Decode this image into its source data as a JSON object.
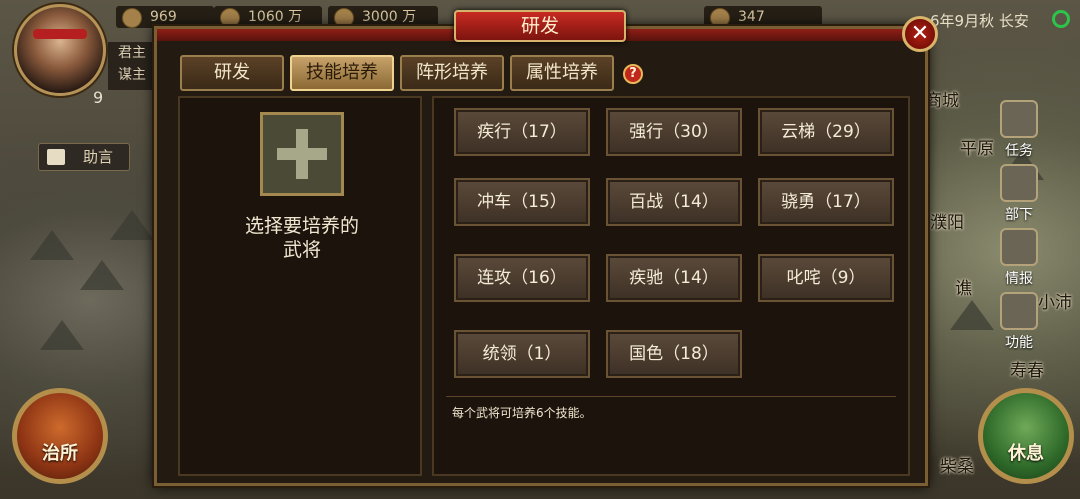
{
  "topbar": {
    "resources": [
      {
        "icon": "coin-icon",
        "value": "969"
      },
      {
        "icon": "grain-icon",
        "value": "1060 万"
      },
      {
        "icon": "troops-icon",
        "value": "3000 万"
      },
      {
        "icon": "scroll-icon",
        "value": "347"
      }
    ],
    "date": "6年9月秋 长安"
  },
  "player": {
    "level": "9",
    "lord_label": "君主",
    "strategist_label": "谋主",
    "help_button": "助言"
  },
  "map": {
    "cities": [
      "商城",
      "平原",
      "濮阳",
      "谯",
      "小沛",
      "寿春",
      "柴桑"
    ]
  },
  "side_menu": [
    "任务",
    "部下",
    "情报",
    "功能"
  ],
  "bottom": {
    "left_button": "治所",
    "right_button": "休息"
  },
  "dialog": {
    "title": "研发",
    "close": "✕",
    "tabs": [
      "研发",
      "技能培养",
      "阵形培养",
      "属性培养"
    ],
    "active_tab": 1,
    "help": "?",
    "select_hint": "选择要培养的武将",
    "skills": [
      "疾行（17）",
      "强行（30）",
      "云梯（29）",
      "冲车（15）",
      "百战（14）",
      "骁勇（17）",
      "连攻（16）",
      "疾驰（14）",
      "叱咤（9）",
      "统领（1）",
      "国色（18）"
    ],
    "note": "每个武将可培养6个技能。"
  }
}
